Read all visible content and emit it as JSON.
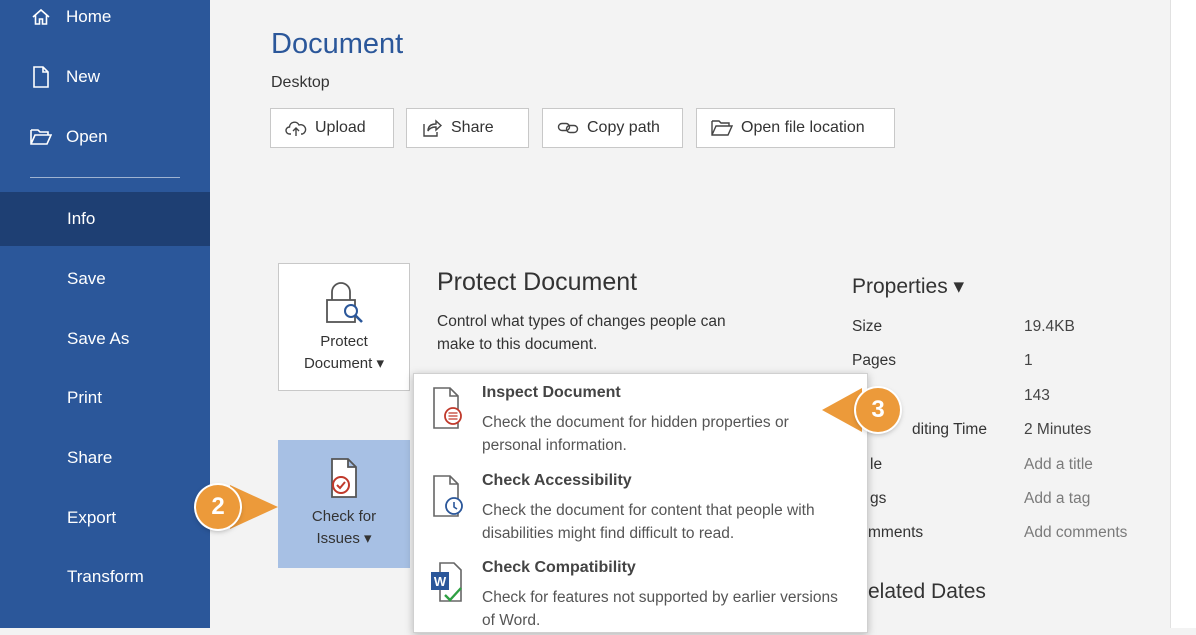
{
  "sidebar": {
    "items": [
      {
        "label": "Home",
        "icon": "home-icon"
      },
      {
        "label": "New",
        "icon": "new-document-icon"
      },
      {
        "label": "Open",
        "icon": "open-folder-icon"
      },
      {
        "label": "Info"
      },
      {
        "label": "Save"
      },
      {
        "label": "Save As"
      },
      {
        "label": "Print"
      },
      {
        "label": "Share"
      },
      {
        "label": "Export"
      },
      {
        "label": "Transform"
      }
    ],
    "active": "Info",
    "color": "#2b579a"
  },
  "document": {
    "title": "Document",
    "location": "Desktop"
  },
  "toolbar": {
    "upload": "Upload",
    "share": "Share",
    "copy_path": "Copy path",
    "open_location": "Open file location"
  },
  "protect": {
    "tile_line1": "Protect",
    "tile_line2": "Document",
    "heading": "Protect Document",
    "description": "Control what types of changes people can make to this document."
  },
  "check_issues": {
    "tile_line1": "Check for",
    "tile_line2": "Issues"
  },
  "dropdown": {
    "items": [
      {
        "title": "Inspect Document",
        "description": "Check the document for hidden properties or personal information."
      },
      {
        "title": "Check Accessibility",
        "description": "Check the document for content that people with disabilities might find difficult to read."
      },
      {
        "title": "Check Compatibility",
        "description": "Check for features not supported by earlier versions of Word."
      }
    ]
  },
  "properties": {
    "title": "Properties",
    "rows": [
      {
        "label": "Size",
        "value": "19.4KB"
      },
      {
        "label": "Pages",
        "value": "1"
      },
      {
        "label": "",
        "value": "143"
      },
      {
        "label": "diting Time",
        "value": "2 Minutes"
      },
      {
        "label": "le",
        "value": "Add a title"
      },
      {
        "label": "gs",
        "value": "Add a tag"
      },
      {
        "label": "mments",
        "value": "Add comments"
      }
    ]
  },
  "related_dates": {
    "title": "elated Dates"
  },
  "callouts": {
    "step2": "2",
    "step3": "3",
    "color": "#ec9a3a"
  }
}
